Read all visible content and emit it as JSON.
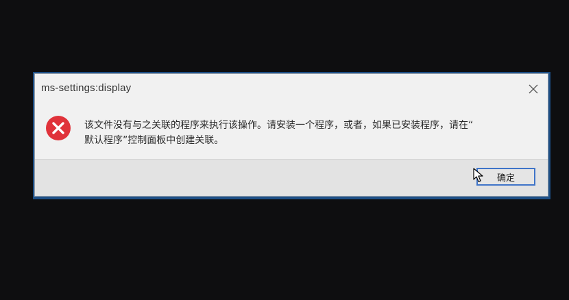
{
  "dialog": {
    "title": "ms-settings:display",
    "message_lines": [
      "该文件没有与之关联的程序来执行该操作。请安装一个程序，或者，如果已安装程序，请在“",
      "默认程序”控制面板中创建关联。"
    ],
    "ok_label": "确定",
    "icons": {
      "status": "error-icon",
      "close": "close-icon",
      "pointer": "mouse-cursor-icon"
    },
    "colors": {
      "error_red": "#e0323a",
      "button_border": "#3f74c8"
    }
  }
}
